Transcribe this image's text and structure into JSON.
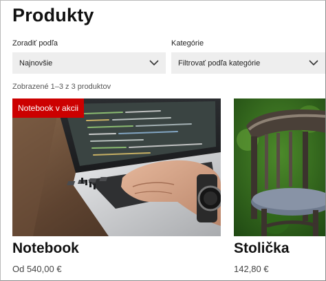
{
  "page": {
    "title": "Produkty"
  },
  "sort": {
    "label": "Zoradiť podľa",
    "selected": "Najnovšie"
  },
  "category": {
    "label": "Kategórie",
    "selected": "Filtrovať podľa kategórie"
  },
  "results": {
    "summary": "Zobrazené 1–3 z 3 produktov"
  },
  "products": [
    {
      "name": "Notebook",
      "price": "Od 540,00 €",
      "badge": "Notebook v akcii",
      "image": "laptop-photo"
    },
    {
      "name": "Stolička",
      "price": "142,80 €",
      "image": "chair-photo"
    }
  ],
  "colors": {
    "badge": "#cc0000",
    "select_bg": "#eeeeee"
  },
  "icons": {
    "dropdown": "chevron-down-icon"
  }
}
